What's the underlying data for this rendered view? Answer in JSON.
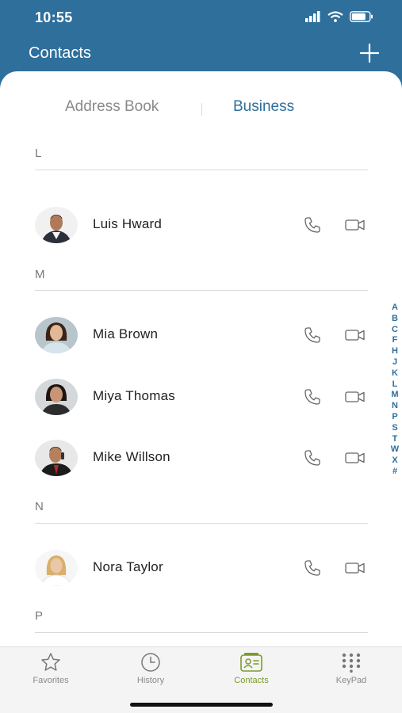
{
  "status_bar": {
    "time": "10:55"
  },
  "header": {
    "title": "Contacts"
  },
  "tabs": {
    "address_book": "Address Book",
    "business": "Business"
  },
  "sections": [
    {
      "letter": "L",
      "contacts": [
        {
          "name": "Luis Hward"
        }
      ]
    },
    {
      "letter": "M",
      "contacts": [
        {
          "name": "Mia Brown"
        },
        {
          "name": "Miya Thomas"
        },
        {
          "name": "Mike Willson"
        }
      ]
    },
    {
      "letter": "N",
      "contacts": [
        {
          "name": "Nora Taylor"
        }
      ]
    },
    {
      "letter": "P",
      "contacts": []
    }
  ],
  "alpha_index": [
    "A",
    "B",
    "C",
    "F",
    "H",
    "J",
    "K",
    "L",
    "M",
    "N",
    "P",
    "S",
    "T",
    "W",
    "X",
    "#"
  ],
  "bottom_tabs": {
    "favorites": "Favorites",
    "history": "History",
    "contacts": "Contacts",
    "keypad": "KeyPad"
  },
  "colors": {
    "brand": "#2e6f9c",
    "active_tab": "#7a9c2a"
  },
  "icons": [
    "signal-icon",
    "wifi-icon",
    "battery-icon",
    "plus-icon",
    "phone-icon",
    "video-icon",
    "star-icon",
    "clock-icon",
    "contacts-card-icon",
    "keypad-icon"
  ]
}
